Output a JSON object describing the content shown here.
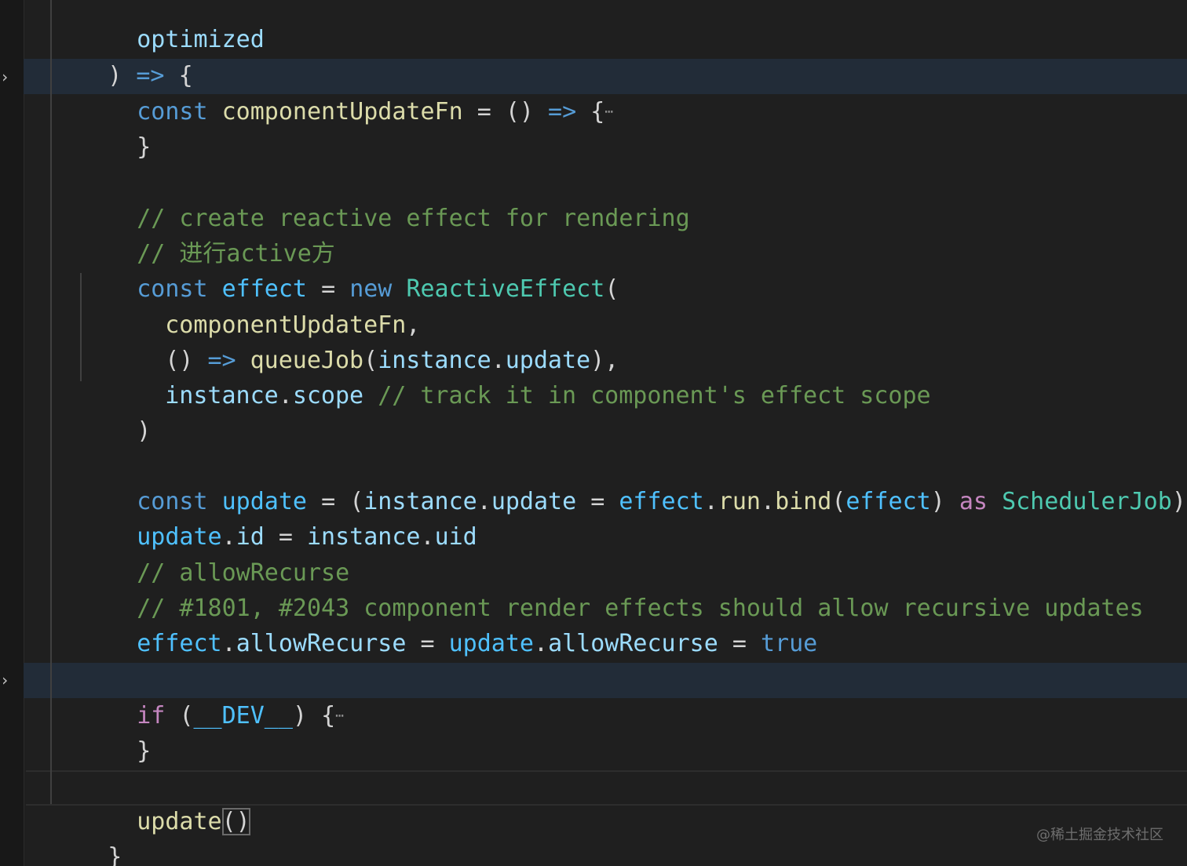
{
  "editor": {
    "theme": {
      "background": "#1f1f1f",
      "gutter": "#181818",
      "line_highlight": "#222c38"
    },
    "lines": {
      "l1": {
        "t1": "optimized"
      },
      "l2": {
        "t1": ")",
        "t2": "=>",
        "t3": "{"
      },
      "l3": {
        "t1": "const",
        "t2": "componentUpdateFn",
        "t3": "=",
        "t4": "()",
        "t5": "=>",
        "t6": "{",
        "t7": "⋯"
      },
      "l4": {
        "t1": "}"
      },
      "l6": {
        "t1": "// create reactive effect for rendering"
      },
      "l7": {
        "t1": "// 进行active方"
      },
      "l8": {
        "t1": "const",
        "t2": "effect",
        "t3": "=",
        "t4": "new",
        "t5": "ReactiveEffect",
        "t6": "("
      },
      "l9": {
        "t1": "componentUpdateFn",
        "t2": ","
      },
      "l10": {
        "t1": "()",
        "t2": "=>",
        "t3": "queueJob",
        "t4": "(",
        "t5": "instance",
        "t6": ".",
        "t7": "update",
        "t8": "),"
      },
      "l11": {
        "t1": "instance",
        "t2": ".",
        "t3": "scope",
        "t4": "// track it in component's effect scope"
      },
      "l12": {
        "t1": ")"
      },
      "l14": {
        "t1": "const",
        "t2": "update",
        "t3": "=",
        "t4": "(",
        "t5": "instance",
        "t6": ".",
        "t7": "update",
        "t8": "=",
        "t9": "effect",
        "t10": ".",
        "t11": "run",
        "t12": ".",
        "t13": "bind",
        "t14": "(",
        "t15": "effect",
        "t16": ")",
        "t17": "as",
        "t18": "SchedulerJob",
        "t19": ")"
      },
      "l15": {
        "t1": "update",
        "t2": ".",
        "t3": "id",
        "t4": "=",
        "t5": "instance",
        "t6": ".",
        "t7": "uid"
      },
      "l16": {
        "t1": "// allowRecurse"
      },
      "l17": {
        "t1": "// #1801, #2043 component render effects should allow recursive updates"
      },
      "l18": {
        "t1": "effect",
        "t2": ".",
        "t3": "allowRecurse",
        "t4": "=",
        "t5": "update",
        "t6": ".",
        "t7": "allowRecurse",
        "t8": "=",
        "t9": "true"
      },
      "l20": {
        "t1": "if",
        "t2": "(",
        "t3": "__DEV__",
        "t4": ")",
        "t5": "{",
        "t6": "⋯"
      },
      "l21": {
        "t1": "}"
      },
      "l23": {
        "t1": "update",
        "t2": "()"
      },
      "l24": {
        "t1": "}"
      }
    }
  },
  "watermark": "@稀土掘金技术社区"
}
